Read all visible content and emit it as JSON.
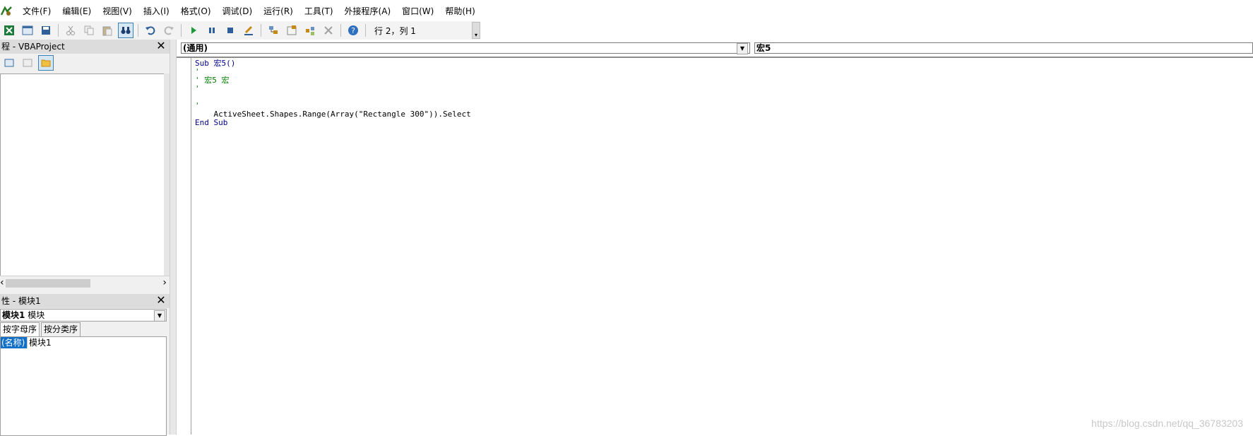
{
  "menu": {
    "items": [
      "文件(F)",
      "编辑(E)",
      "视图(V)",
      "插入(I)",
      "格式(O)",
      "调试(D)",
      "运行(R)",
      "工具(T)",
      "外接程序(A)",
      "窗口(W)",
      "帮助(H)"
    ]
  },
  "toolbar": {
    "cursor_position": "行 2，列 1"
  },
  "project": {
    "title": "程 - VBAProject"
  },
  "properties": {
    "title": "性 - 模块1",
    "object_name": "模块1",
    "object_type": "模块",
    "tabs": [
      "按字母序",
      "按分类序"
    ],
    "rows": [
      {
        "name": "(名称)",
        "value": "模块1"
      }
    ]
  },
  "code_window": {
    "object_combo": "(通用)",
    "procedure_combo": "宏5",
    "lines": [
      {
        "text": "Sub 宏5()",
        "kind": "keyword"
      },
      {
        "text": "'",
        "kind": "comment"
      },
      {
        "text": "' 宏5 宏",
        "kind": "comment"
      },
      {
        "text": "'",
        "kind": "comment"
      },
      {
        "text": "",
        "kind": "plain"
      },
      {
        "text": "'",
        "kind": "comment"
      },
      {
        "text": "    ActiveSheet.Shapes.Range(Array(\"Rectangle 300\")).Select",
        "kind": "plain"
      },
      {
        "text": "End Sub",
        "kind": "keyword"
      }
    ]
  },
  "watermark": "https://blog.csdn.net/qq_36783203",
  "colors": {
    "keyword": "#00008b",
    "comment": "#008000",
    "selection": "#1070c8"
  }
}
